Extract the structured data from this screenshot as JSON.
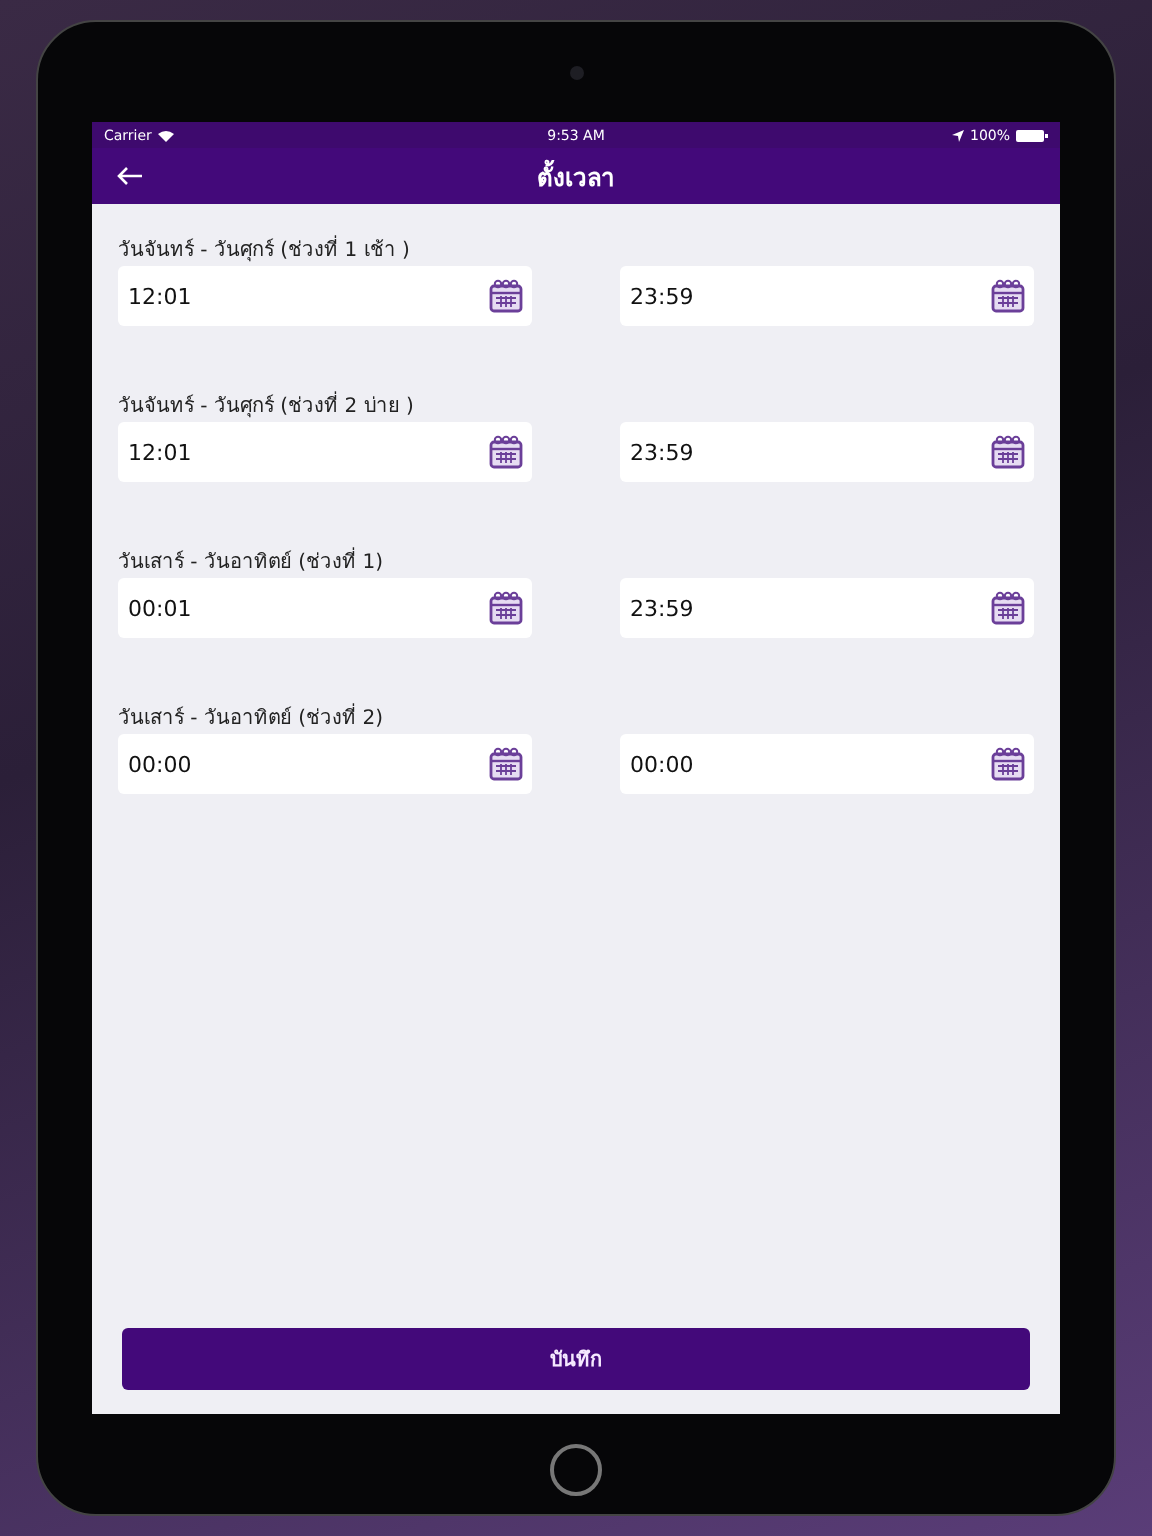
{
  "status_bar": {
    "carrier": "Carrier",
    "time": "9:53 AM",
    "battery": "100%"
  },
  "nav": {
    "title": "ตั้งเวลา"
  },
  "groups": [
    {
      "label": "วันจันทร์ - วันศุกร์ (ช่วงที่ 1 เช้า )",
      "start": "12:01",
      "end": "23:59"
    },
    {
      "label": "วันจันทร์ - วันศุกร์ (ช่วงที่ 2 บ่าย )",
      "start": "12:01",
      "end": "23:59"
    },
    {
      "label": "วันเสาร์ - วันอาทิตย์ (ช่วงที่ 1)",
      "start": "00:01",
      "end": "23:59"
    },
    {
      "label": "วันเสาร์ - วันอาทิตย์ (ช่วงที่ 2)",
      "start": "00:00",
      "end": "00:00"
    }
  ],
  "save_button": "บันทึก"
}
